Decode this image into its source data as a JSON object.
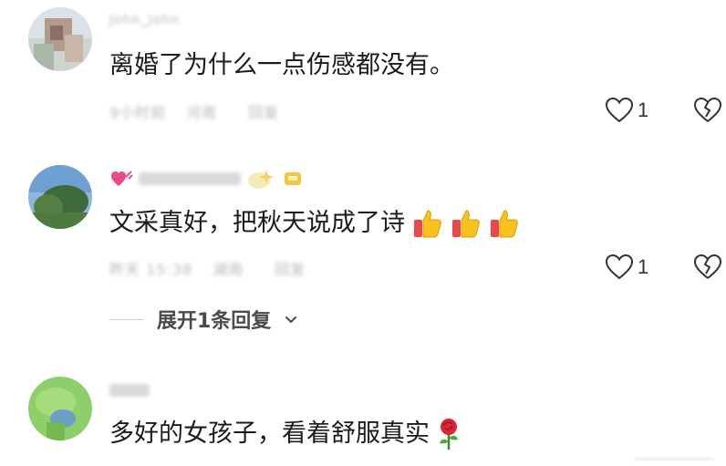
{
  "comments": [
    {
      "username": "John_John",
      "text": "离婚了为什么一点伤感都没有。",
      "meta_time": "9小时前",
      "meta_location": "河南",
      "meta_reply": "回复",
      "likes": "1"
    },
    {
      "username": "",
      "text": "文采真好，把秋天说成了诗",
      "meta_time": "昨天 15:38",
      "meta_location": "湖南",
      "meta_reply": "回复",
      "likes": "1",
      "expand_label": "展开1条回复"
    },
    {
      "username": "",
      "text": "多好的女孩子，看着舒服真实"
    }
  ],
  "icons": {
    "like": "heart-outline-icon",
    "dislike": "broken-heart-icon",
    "expand": "chevron-down-icon",
    "thumbs": "thumbs-up-emoji",
    "rose": "rose-emoji"
  },
  "colors": {
    "text": "#1b1b1b",
    "meta": "#b8b8b8",
    "emoji_yellow": "#f7c21b",
    "emoji_red": "#e8494a"
  }
}
